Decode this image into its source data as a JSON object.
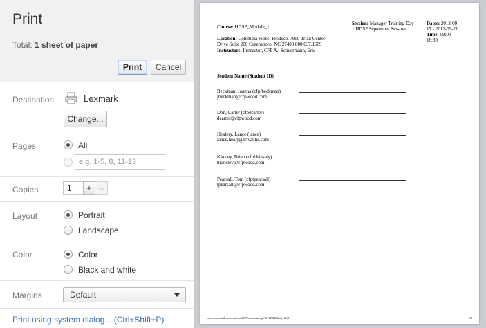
{
  "header": {
    "title": "Print",
    "total_prefix": "Total:",
    "total_value": "1 sheet of paper",
    "print_label": "Print",
    "cancel_label": "Cancel"
  },
  "destination": {
    "label": "Destination",
    "printer": "Lexmark",
    "change_label": "Change...",
    "icon": "printer-icon"
  },
  "pages": {
    "label": "Pages",
    "all_label": "All",
    "custom_placeholder": "e.g. 1-5, 8, 11-13",
    "selected": "All"
  },
  "copies": {
    "label": "Copies",
    "value": "1",
    "plus": "+",
    "minus": "–"
  },
  "layout": {
    "label": "Layout",
    "portrait": "Portrait",
    "landscape": "Landscape",
    "selected": "Portrait"
  },
  "color": {
    "label": "Color",
    "color": "Color",
    "bw": "Black and white",
    "selected": "Color"
  },
  "margins": {
    "label": "Margins",
    "value": "Default"
  },
  "system_dialog": "Print using system dialog... (Ctrl+Shift+P)",
  "preview": {
    "course_label": "Course:",
    "course_value": "HDSP_Module_1",
    "session_label": "Session:",
    "session_value_1": "Manager Training Day",
    "session_value_2": "1 HDSP September Session",
    "dates_label": "Dates:",
    "dates_value_1": "2012-09-",
    "dates_value_2": "17 - 2012-09-21",
    "time_label": "Time:",
    "time_value_1": "08:00 -",
    "time_value_2": "16:30",
    "location_label": "Location:",
    "location_value_1": "Columbia Forest Products 7900 Triad Center",
    "location_value_2": "Drive Suite 200 Greensboro, NC 27409 800.637.1609",
    "instructors_label": "Instructors:",
    "instructors_value": "Instructor, CFP A.; Schuermann, Eric",
    "student_header": "Student Name (Student ID)",
    "students": [
      {
        "name": "Beckman, Joanna (cfpjbeckman)",
        "email": "jbeckman@cfpwood.com"
      },
      {
        "name": "Don, Carter (cfpdcarter)",
        "email": "dcarter@cfpwood.com"
      },
      {
        "name": "Healery, Lance (lance)",
        "email": "lance.healy@trivantis.com"
      },
      {
        "name": "Kinsley, Brian (cfpbkinsley)",
        "email": "bkinsley@cfpwood.com"
      },
      {
        "name": "Pearsall, Tom (cfptpearsall)",
        "email": "tpearsall@cfpwood.com"
      }
    ],
    "footer_url": "www.coursemill.com/cmil/cmil/671/classroster.jsp?id=31084&lang=USA",
    "footer_page": "1/1"
  },
  "colors": {
    "link": "#3b6fb7",
    "header_bg": "#f1f1f1",
    "preview_bg": "#c9cdd1"
  }
}
